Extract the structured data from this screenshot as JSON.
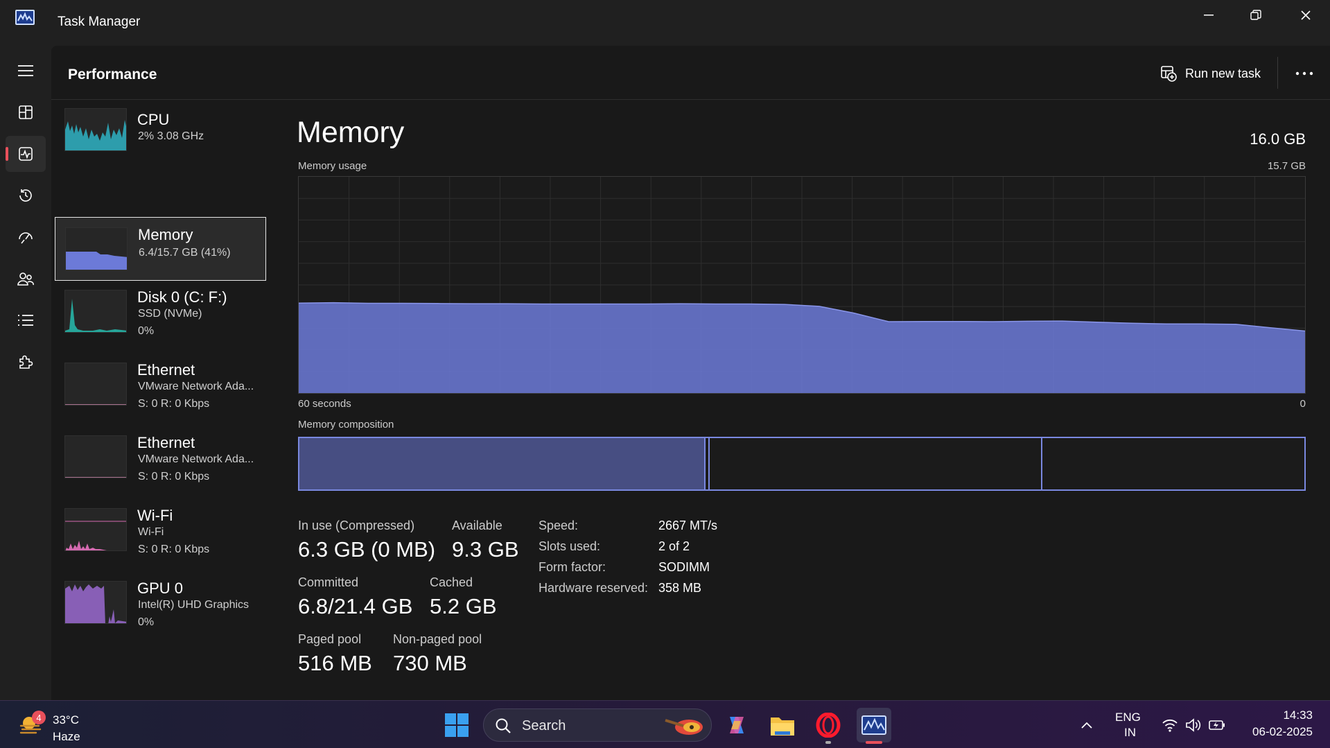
{
  "window": {
    "title": "Task Manager"
  },
  "header": {
    "page_title": "Performance",
    "run_new_task": "Run new task"
  },
  "resources": [
    {
      "name": "CPU",
      "sub1": "2%  3.08 GHz",
      "sub2": "",
      "graph_color": "#2fb3c4"
    },
    {
      "name": "Memory",
      "sub1": "6.4/15.7 GB (41%)",
      "sub2": "",
      "graph_color": "#6c7ad8"
    },
    {
      "name": "Disk 0 (C: F:)",
      "sub1": "SSD (NVMe)",
      "sub2": "0%",
      "graph_color": "#26a69a"
    },
    {
      "name": "Ethernet",
      "sub1": "VMware Network Ada...",
      "sub2": "S: 0  R: 0 Kbps",
      "graph_color": "#d48ab0"
    },
    {
      "name": "Ethernet",
      "sub1": "VMware Network Ada...",
      "sub2": "S: 0  R: 0 Kbps",
      "graph_color": "#d48ab0"
    },
    {
      "name": "Wi-Fi",
      "sub1": "Wi-Fi",
      "sub2": "S: 0  R: 0 Kbps",
      "graph_color": "#d46ab0"
    },
    {
      "name": "GPU 0",
      "sub1": "Intel(R) UHD Graphics",
      "sub2": "0%",
      "graph_color": "#9a6ad0"
    }
  ],
  "memory": {
    "title": "Memory",
    "total": "16.0 GB",
    "usage_label": "Memory usage",
    "usage_max": "15.7 GB",
    "time_left": "60 seconds",
    "time_right": "0",
    "composition_label": "Memory composition",
    "in_use_label": "In use (Compressed)",
    "in_use_value": "6.3 GB (0 MB)",
    "available_label": "Available",
    "available_value": "9.3 GB",
    "committed_label": "Committed",
    "committed_value": "6.8/21.4 GB",
    "cached_label": "Cached",
    "cached_value": "5.2 GB",
    "paged_label": "Paged pool",
    "paged_value": "516 MB",
    "nonpaged_label": "Non-paged pool",
    "nonpaged_value": "730 MB",
    "props": [
      {
        "label": "Speed:",
        "value": "2667 MT/s"
      },
      {
        "label": "Slots used:",
        "value": "2 of 2"
      },
      {
        "label": "Form factor:",
        "value": "SODIMM"
      },
      {
        "label": "Hardware reserved:",
        "value": "358 MB"
      }
    ],
    "usage_history_percent": [
      41.6,
      41.8,
      41.5,
      41.5,
      41.4,
      41.3,
      41.3,
      41.2,
      41.2,
      41.2,
      41.2,
      41.3,
      41.2,
      41.2,
      41.0,
      40.1,
      37.0,
      33.0,
      33.1,
      33.1,
      33.0,
      33.2,
      33.3,
      32.8,
      32.3,
      32.0,
      32.0,
      31.8,
      30.2,
      28.7
    ],
    "accent_color": "#6c7ad8"
  },
  "taskbar": {
    "weather_badge": "4",
    "temperature": "33°C",
    "condition": "Haze",
    "search_placeholder": "Search",
    "lang_top": "ENG",
    "lang_bottom": "IN",
    "time": "14:33",
    "date": "06-02-2025"
  }
}
